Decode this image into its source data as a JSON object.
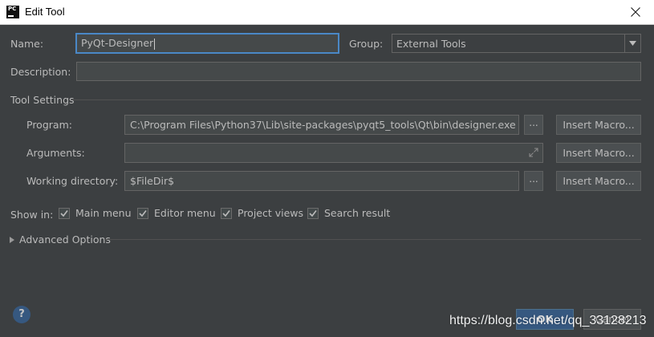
{
  "window": {
    "title": "Edit Tool",
    "app_icon_text": "PC"
  },
  "form": {
    "name_label": "Name:",
    "name_value": "PyQt-Designer",
    "group_label": "Group:",
    "group_value": "External Tools",
    "description_label": "Description:",
    "description_value": ""
  },
  "tool_settings": {
    "title": "Tool Settings",
    "program_label": "Program:",
    "program_value": "C:\\Program Files\\Python37\\Lib\\site-packages\\pyqt5_tools\\Qt\\bin\\designer.exe",
    "arguments_label": "Arguments:",
    "arguments_value": "",
    "working_dir_label": "Working directory:",
    "working_dir_value": "$FileDir$",
    "browse_label": "...",
    "insert_macro_label": "Insert Macro..."
  },
  "show_in": {
    "label": "Show in:",
    "options": [
      {
        "label": "Main menu",
        "checked": true
      },
      {
        "label": "Editor menu",
        "checked": true
      },
      {
        "label": "Project views",
        "checked": true
      },
      {
        "label": "Search result",
        "checked": true
      }
    ]
  },
  "advanced": {
    "label": "Advanced Options"
  },
  "footer": {
    "help_label": "?",
    "ok_label": "OK",
    "cancel_label": "Cancel"
  },
  "watermark": "https://blog.csdn.net/qq_33128213",
  "colors": {
    "background": "#3c3f41",
    "field_bg": "#45494a",
    "focus_border": "#4a88c7",
    "primary_button": "#365880",
    "text": "#bbbbbb"
  }
}
